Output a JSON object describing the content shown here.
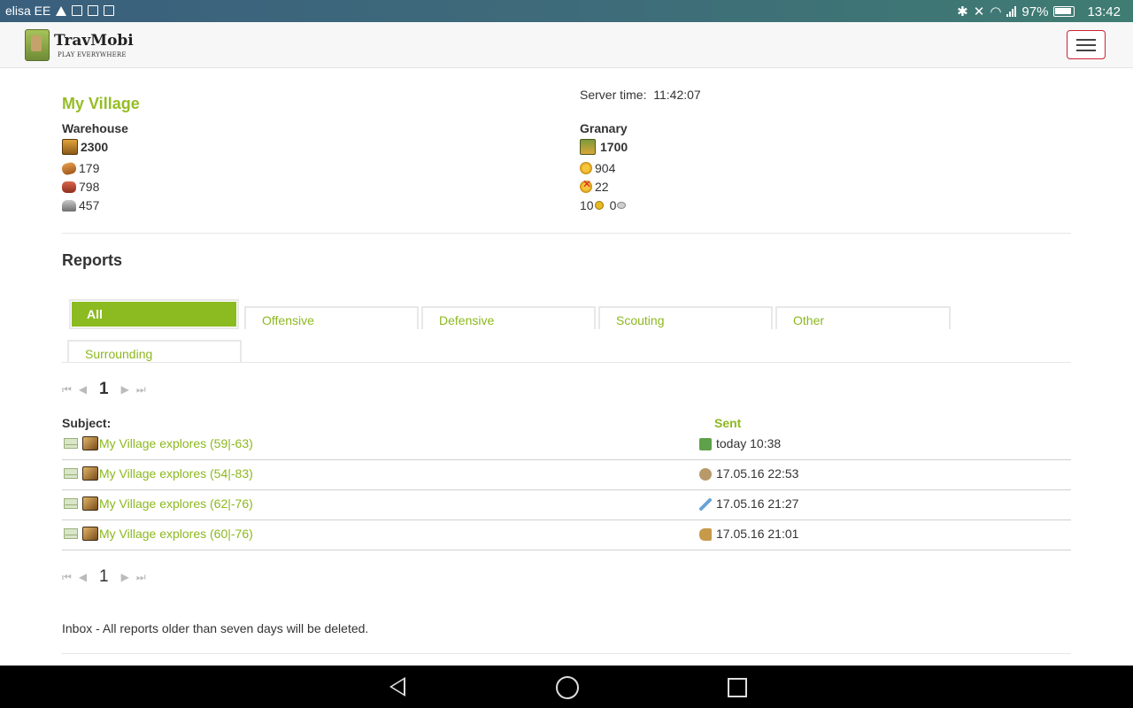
{
  "status_bar": {
    "carrier": "elisa EE",
    "battery": "97%",
    "time": "13:42"
  },
  "app": {
    "name": "TravMobi",
    "tagline": "PLAY EVERYWHERE"
  },
  "village": {
    "name": "My Village",
    "server_time_label": "Server time:",
    "server_time": "11:42:07"
  },
  "warehouse": {
    "label": "Warehouse",
    "capacity": "2300",
    "lumber": "179",
    "clay": "798",
    "iron": "457"
  },
  "granary": {
    "label": "Granary",
    "capacity": "1700",
    "crop": "904",
    "crop_consumption": "22",
    "gold": "10",
    "silver": "0"
  },
  "reports": {
    "title": "Reports",
    "tabs": [
      {
        "label": "All",
        "active": true
      },
      {
        "label": "Offensive",
        "active": false
      },
      {
        "label": "Defensive",
        "active": false
      },
      {
        "label": "Scouting",
        "active": false
      },
      {
        "label": "Other",
        "active": false
      },
      {
        "label": "Surrounding",
        "active": false
      }
    ],
    "current_page": "1",
    "col_subject": "Subject:",
    "col_sent": "Sent",
    "rows": [
      {
        "subject": "My Village explores (59|-63)",
        "sent": "today 10:38",
        "icon": "resources-icon",
        "icon_color": "#5fa04a"
      },
      {
        "subject": "My Village explores (54|-83)",
        "sent": "17.05.16 22:53",
        "icon": "bag-icon",
        "icon_color": "#b89a6a"
      },
      {
        "subject": "My Village explores (62|-76)",
        "sent": "17.05.16 21:27",
        "icon": "sword-icon",
        "icon_color": "#6aa2d8"
      },
      {
        "subject": "My Village explores (60|-76)",
        "sent": "17.05.16 21:01",
        "icon": "horse-icon",
        "icon_color": "#c79a4a"
      }
    ],
    "notice": "Inbox - All reports older than seven days will be deleted."
  },
  "colors": {
    "accent": "#8db81f",
    "active_tab": "#8bbb20",
    "menu_border": "#cc2233"
  }
}
